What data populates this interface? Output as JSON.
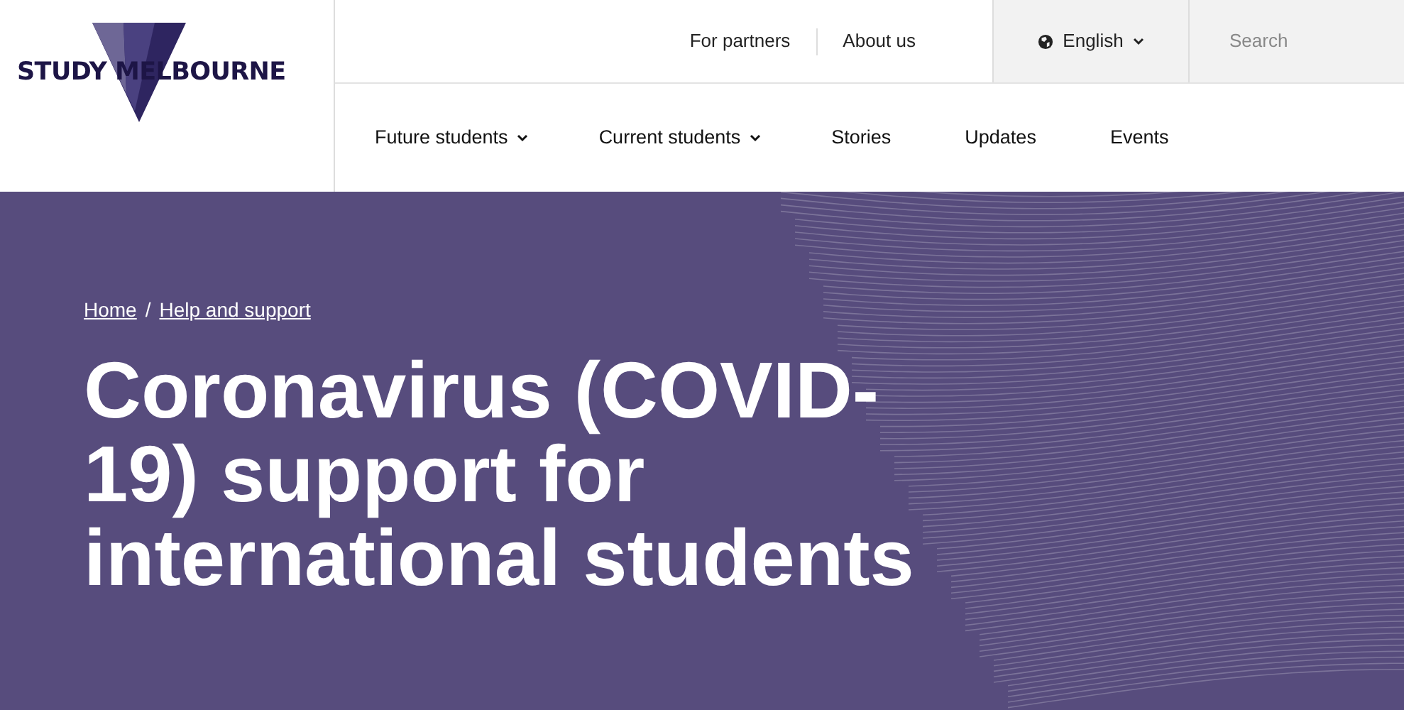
{
  "logo": {
    "text": "STUDY MELBOURNE"
  },
  "utility_links": [
    "For partners",
    "About us"
  ],
  "language": {
    "label": "English"
  },
  "search": {
    "placeholder": "Search"
  },
  "nav": [
    {
      "label": "Future students",
      "dropdown": true
    },
    {
      "label": "Current students",
      "dropdown": true
    },
    {
      "label": "Stories",
      "dropdown": false
    },
    {
      "label": "Updates",
      "dropdown": false
    },
    {
      "label": "Events",
      "dropdown": false
    }
  ],
  "breadcrumb": {
    "separator": "/",
    "items": [
      "Home",
      "Help and support"
    ]
  },
  "hero": {
    "title": "Coronavirus (COVID-19) support for international students"
  }
}
